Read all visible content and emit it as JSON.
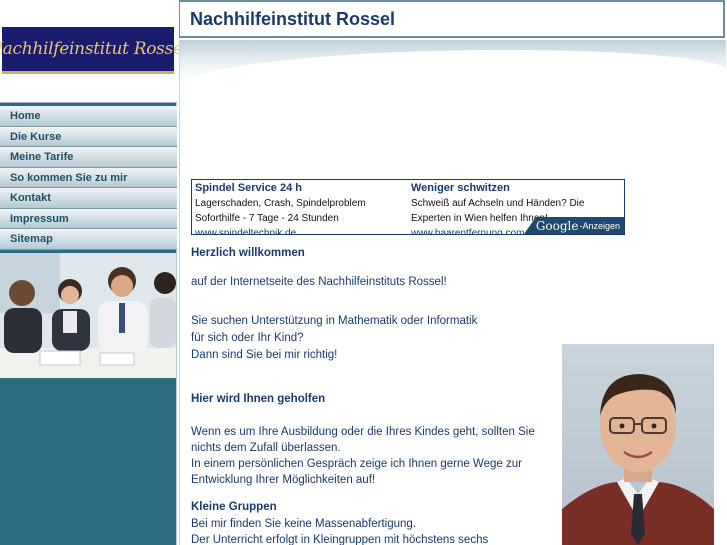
{
  "logo": {
    "text": "Nachhilfeinstitut Rossel"
  },
  "site_title": "Nachhilfeinstitut Rossel",
  "nav": {
    "items": [
      {
        "label": "Home"
      },
      {
        "label": "Die Kurse"
      },
      {
        "label": "Meine Tarife"
      },
      {
        "label": "So kommen Sie zu mir"
      },
      {
        "label": "Kontakt"
      },
      {
        "label": "Impressum"
      },
      {
        "label": "Sitemap"
      }
    ]
  },
  "ads": [
    {
      "title": "Spindel Service 24 h",
      "line1": "Lagerschaden, Crash, Spindelproblem",
      "line2": "Soforthilfe - 7 Tage - 24 Stunden",
      "url": "www.spindeltechnik.de"
    },
    {
      "title": "Weniger schwitzen",
      "line1": "Schweiß auf Achseln und Händen? Die",
      "line2": "Experten in Wien helfen Ihnen!",
      "url": "www.haarentfernung.com"
    }
  ],
  "google_badge": {
    "brand": "Google",
    "suffix": "-Anzeigen"
  },
  "content": {
    "welcome_heading": "Herzlich willkommen",
    "welcome_text": "auf der Internetseite des Nachhilfeinstituts Rossel!",
    "intro_line1": "Sie suchen Unterstützung in Mathematik oder Informatik",
    "intro_line2": "für sich oder Ihr Kind?",
    "intro_line3": "Dann sind Sie bei mir richtig!",
    "help_heading": "Hier wird Ihnen geholfen",
    "help_line1": "Wenn es um Ihre Ausbildung oder die Ihres Kindes geht, sollten Sie",
    "help_line2": "nichts dem Zufall überlassen.",
    "help_line3": "In einem persönlichen Gespräch zeige ich Ihnen gerne Wege zur",
    "help_line4": "Entwicklung Ihrer Möglichkeiten auf!",
    "groups_heading": "Kleine Gruppen",
    "groups_line1": "Bei mir finden Sie keine Massenabfertigung.",
    "groups_line2": "Der Unterricht erfolgt in Kleingruppen mit höchstens sechs"
  }
}
